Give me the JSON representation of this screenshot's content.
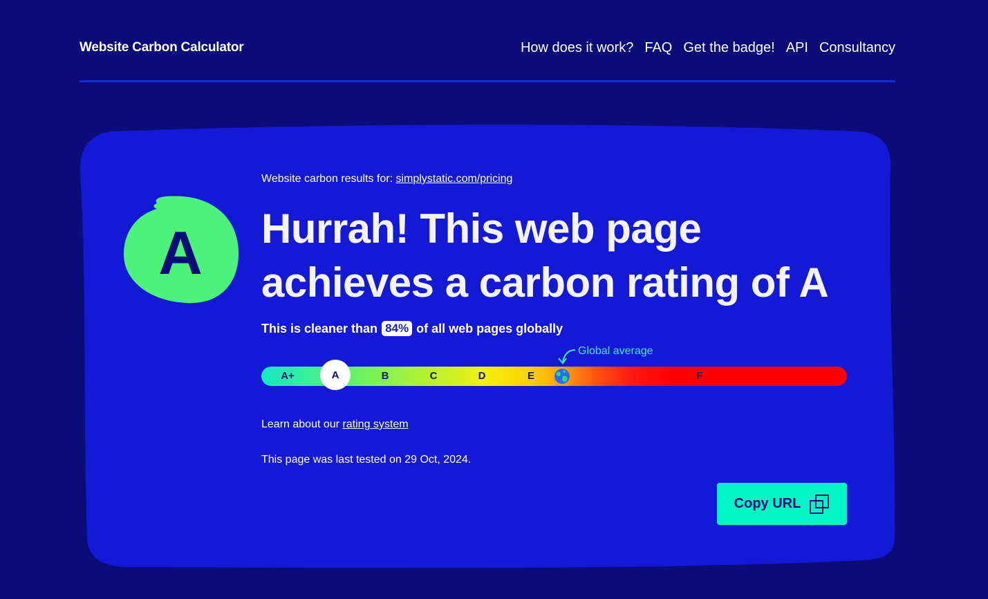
{
  "header": {
    "brand": "Website Carbon Calculator",
    "nav": [
      "How does it work?",
      "FAQ",
      "Get the badge!",
      "API",
      "Consultancy"
    ]
  },
  "result": {
    "grade": "A",
    "results_for_prefix": "Website carbon results for:",
    "results_for_url": "simplystatic.com/pricing",
    "headline": "Hurrah! This web page achieves a carbon rating of A",
    "cleaner_prefix": "This is cleaner than",
    "cleaner_percent": "84%",
    "cleaner_suffix": "of all web pages globally",
    "global_average_label": "Global average",
    "scale": {
      "grades": [
        "A+",
        "A",
        "B",
        "C",
        "D",
        "E",
        "F"
      ],
      "current": "A"
    },
    "learn_prefix": "Learn about our",
    "learn_link": "rating system",
    "last_tested": "This page was last tested on 29 Oct, 2024.",
    "copy_button": "Copy URL"
  },
  "colors": {
    "page_bg": "#0a0c78",
    "card_bg": "#1419d6",
    "grade_blob": "#4cf27a",
    "accent_button": "#00f5c3",
    "global_average": "#3ee8c5"
  },
  "icons": [
    "earth-icon",
    "curved-arrow-icon",
    "copy-icon"
  ]
}
